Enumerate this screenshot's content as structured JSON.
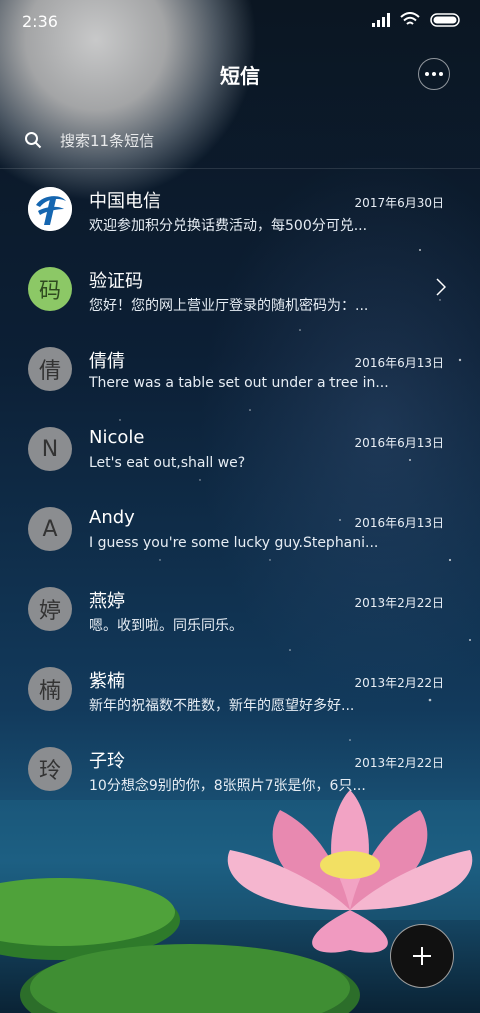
{
  "status_bar": {
    "time": "2:36"
  },
  "header": {
    "title": "短信"
  },
  "search": {
    "placeholder": "搜索11条短信"
  },
  "conversations": [
    {
      "name": "中国电信",
      "date": "2017年6月30日",
      "preview": "欢迎参加积分兑换话费活动，每500分可兑...",
      "avatar": ""
    },
    {
      "name": "验证码",
      "date": "",
      "preview": "您好！您的网上营业厅登录的随机密码为：...",
      "avatar": "码"
    },
    {
      "name": "倩倩",
      "date": "2016年6月13日",
      "preview": "There was a table set out under a tree in...",
      "avatar": "倩"
    },
    {
      "name": "Nicole",
      "date": "2016年6月13日",
      "preview": "Let's eat out,shall we?",
      "avatar": "N"
    },
    {
      "name": "Andy",
      "date": "2016年6月13日",
      "preview": "I guess you're some lucky guy.Stephani...",
      "avatar": "A"
    },
    {
      "name": "燕婷",
      "date": "2013年2月22日",
      "preview": "嗯。收到啦。同乐同乐。",
      "avatar": "婷"
    },
    {
      "name": "紫楠",
      "date": "2013年2月22日",
      "preview": "新年的祝福数不胜数，新年的愿望好多好...",
      "avatar": "楠"
    },
    {
      "name": "子玲",
      "date": "2013年2月22日",
      "preview": "10分想念9别的你，8张照片7张是你，6只...",
      "avatar": "玲"
    }
  ]
}
